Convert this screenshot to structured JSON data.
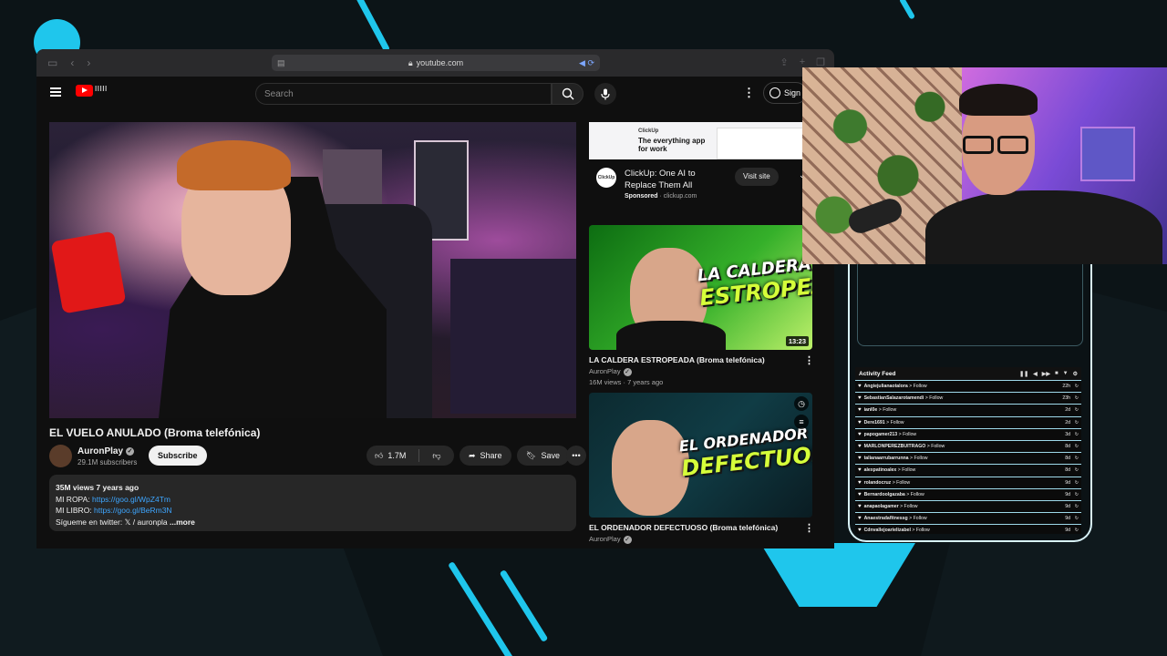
{
  "browser": {
    "url": "youtube.com"
  },
  "youtube": {
    "logo_doodle": "ǀǀǀǀǀ",
    "search_placeholder": "Search",
    "signin_label": "Sign",
    "video": {
      "title": "EL VUELO ANULADO (Broma telefónica)",
      "channel": "AuronPlay",
      "subscribers": "29.1M subscribers",
      "subscribe_label": "Subscribe",
      "likes": "1.7M",
      "share_label": "Share",
      "save_label": "Save",
      "description": {
        "meta": "35M views  7 years ago",
        "line1_label": "MI ROPA: ",
        "line1_link": "https://goo.gl/WpZ4Tm",
        "line2_label": "MI LIBRO: ",
        "line2_link": "https://goo.gl/BeRm3N",
        "line3": "Sígueme en twitter:  𝕏  / auronpla",
        "more": "...more"
      }
    },
    "ad": {
      "brand": "ClickUp",
      "tagline": "The everything app for work",
      "title": "ClickUp: One AI to Replace Them All",
      "sponsored": "Sponsored",
      "domain": "clickup.com",
      "button": "Visit site"
    },
    "recommendations": [
      {
        "thumb_line1": "LA CALDERA",
        "thumb_line2": "ESTROPEADA",
        "duration": "13:23",
        "title": "LA CALDERA ESTROPEADA (Broma telefónica)",
        "channel": "AuronPlay",
        "meta": "16M views · 7 years ago"
      },
      {
        "thumb_line1": "EL ORDENADOR",
        "thumb_line2": "DEFECTUOSO",
        "title": "EL ORDENADOR DEFECTUOSO (Broma telefónica)",
        "channel": "AuronPlay"
      }
    ]
  },
  "activity_feed": {
    "title": "Activity Feed",
    "rows": [
      {
        "user": "Angiejulianaotalora",
        "action": "Follow",
        "time": "22h"
      },
      {
        "user": "SebastianSalazarotamendi",
        "action": "Follow",
        "time": "23h"
      },
      {
        "user": "ianl0e",
        "action": "Follow",
        "time": "2d"
      },
      {
        "user": "Dere1691",
        "action": "Follow",
        "time": "2d"
      },
      {
        "user": "papogamer213",
        "action": "Follow",
        "time": "3d"
      },
      {
        "user": "MARLONPEREZBUITRAGO",
        "action": "Follow",
        "time": "8d"
      },
      {
        "user": "talianaarrubarrunna",
        "action": "Follow",
        "time": "8d"
      },
      {
        "user": "alexpatinoalex",
        "action": "Follow",
        "time": "8d"
      },
      {
        "user": "rolandocruz",
        "action": "Follow",
        "time": "9d"
      },
      {
        "user": "Bernardoolgazaba",
        "action": "Follow",
        "time": "9d"
      },
      {
        "user": "anapaolagamer",
        "action": "Follow",
        "time": "9d"
      },
      {
        "user": "Anaestradafitnessg",
        "action": "Follow",
        "time": "9d"
      },
      {
        "user": "Cdnvallejoarielizabel",
        "action": "Follow",
        "time": "9d"
      }
    ]
  },
  "colors": {
    "accent": "#1fc6ec",
    "yt_red": "#ff0000",
    "link": "#3ea6ff",
    "thumb_green": "#35b02a"
  }
}
